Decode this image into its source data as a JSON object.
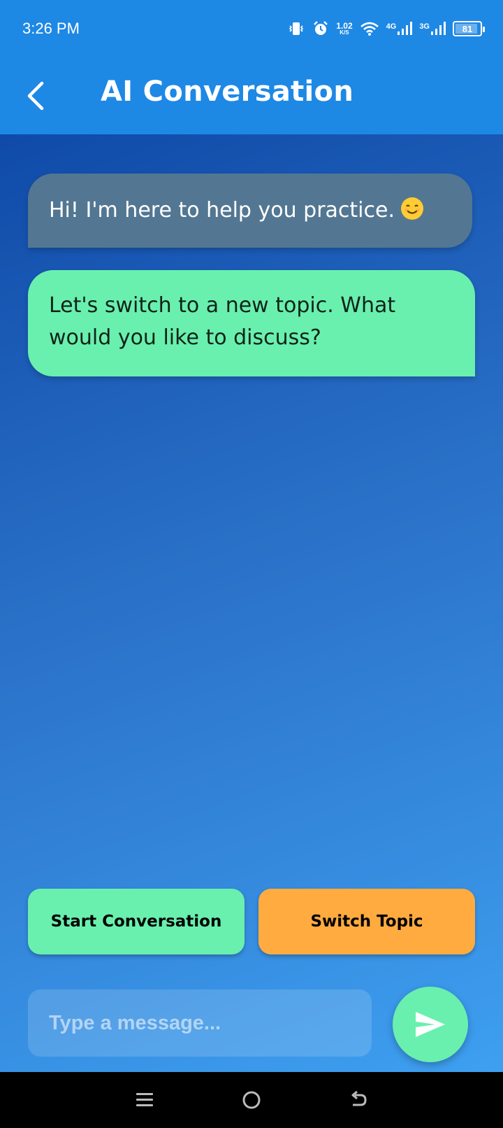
{
  "status_bar": {
    "time": "3:26 PM",
    "net_speed_value": "1.02",
    "net_speed_unit": "K/S",
    "signal1_label": "4G",
    "signal2_label": "3G",
    "battery": "81",
    "icons": [
      "vibrate-icon",
      "alarm-icon",
      "wifi-icon",
      "signal-icon",
      "battery-icon"
    ]
  },
  "app_bar": {
    "title": "AI Conversation",
    "back_icon": "chevron-left-icon"
  },
  "messages": [
    {
      "sender": "ai",
      "text": "Hi! I'm here to help you practice.",
      "emoji": "smiling-face-icon"
    },
    {
      "sender": "user",
      "text": "Let's switch to a new topic. What would you like to discuss?"
    }
  ],
  "actions": {
    "start_label": "Start Conversation",
    "switch_label": "Switch Topic"
  },
  "composer": {
    "placeholder": "Type a message...",
    "value": "",
    "send_icon": "send-icon"
  },
  "nav_bar": {
    "icons": [
      "menu-icon",
      "home-icon",
      "back-icon"
    ]
  },
  "colors": {
    "app_bar": "#1e88e5",
    "ai_bubble": "#537792",
    "user_bubble": "#69f0ae",
    "start_button": "#69f0ae",
    "switch_button": "#ffab40",
    "send_button": "#69f0ae"
  }
}
